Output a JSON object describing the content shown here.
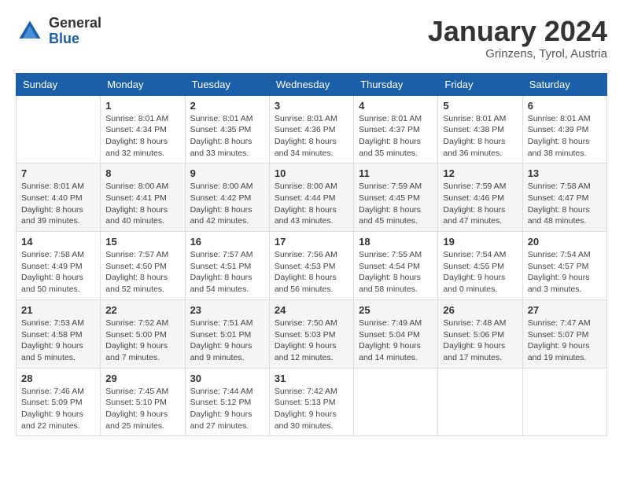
{
  "logo": {
    "general": "General",
    "blue": "Blue"
  },
  "header": {
    "month": "January 2024",
    "location": "Grinzens, Tyrol, Austria"
  },
  "weekdays": [
    "Sunday",
    "Monday",
    "Tuesday",
    "Wednesday",
    "Thursday",
    "Friday",
    "Saturday"
  ],
  "weeks": [
    [
      {
        "day": "",
        "info": ""
      },
      {
        "day": "1",
        "info": "Sunrise: 8:01 AM\nSunset: 4:34 PM\nDaylight: 8 hours\nand 32 minutes."
      },
      {
        "day": "2",
        "info": "Sunrise: 8:01 AM\nSunset: 4:35 PM\nDaylight: 8 hours\nand 33 minutes."
      },
      {
        "day": "3",
        "info": "Sunrise: 8:01 AM\nSunset: 4:36 PM\nDaylight: 8 hours\nand 34 minutes."
      },
      {
        "day": "4",
        "info": "Sunrise: 8:01 AM\nSunset: 4:37 PM\nDaylight: 8 hours\nand 35 minutes."
      },
      {
        "day": "5",
        "info": "Sunrise: 8:01 AM\nSunset: 4:38 PM\nDaylight: 8 hours\nand 36 minutes."
      },
      {
        "day": "6",
        "info": "Sunrise: 8:01 AM\nSunset: 4:39 PM\nDaylight: 8 hours\nand 38 minutes."
      }
    ],
    [
      {
        "day": "7",
        "info": "Sunrise: 8:01 AM\nSunset: 4:40 PM\nDaylight: 8 hours\nand 39 minutes."
      },
      {
        "day": "8",
        "info": "Sunrise: 8:00 AM\nSunset: 4:41 PM\nDaylight: 8 hours\nand 40 minutes."
      },
      {
        "day": "9",
        "info": "Sunrise: 8:00 AM\nSunset: 4:42 PM\nDaylight: 8 hours\nand 42 minutes."
      },
      {
        "day": "10",
        "info": "Sunrise: 8:00 AM\nSunset: 4:44 PM\nDaylight: 8 hours\nand 43 minutes."
      },
      {
        "day": "11",
        "info": "Sunrise: 7:59 AM\nSunset: 4:45 PM\nDaylight: 8 hours\nand 45 minutes."
      },
      {
        "day": "12",
        "info": "Sunrise: 7:59 AM\nSunset: 4:46 PM\nDaylight: 8 hours\nand 47 minutes."
      },
      {
        "day": "13",
        "info": "Sunrise: 7:58 AM\nSunset: 4:47 PM\nDaylight: 8 hours\nand 48 minutes."
      }
    ],
    [
      {
        "day": "14",
        "info": "Sunrise: 7:58 AM\nSunset: 4:49 PM\nDaylight: 8 hours\nand 50 minutes."
      },
      {
        "day": "15",
        "info": "Sunrise: 7:57 AM\nSunset: 4:50 PM\nDaylight: 8 hours\nand 52 minutes."
      },
      {
        "day": "16",
        "info": "Sunrise: 7:57 AM\nSunset: 4:51 PM\nDaylight: 8 hours\nand 54 minutes."
      },
      {
        "day": "17",
        "info": "Sunrise: 7:56 AM\nSunset: 4:53 PM\nDaylight: 8 hours\nand 56 minutes."
      },
      {
        "day": "18",
        "info": "Sunrise: 7:55 AM\nSunset: 4:54 PM\nDaylight: 8 hours\nand 58 minutes."
      },
      {
        "day": "19",
        "info": "Sunrise: 7:54 AM\nSunset: 4:55 PM\nDaylight: 9 hours\nand 0 minutes."
      },
      {
        "day": "20",
        "info": "Sunrise: 7:54 AM\nSunset: 4:57 PM\nDaylight: 9 hours\nand 3 minutes."
      }
    ],
    [
      {
        "day": "21",
        "info": "Sunrise: 7:53 AM\nSunset: 4:58 PM\nDaylight: 9 hours\nand 5 minutes."
      },
      {
        "day": "22",
        "info": "Sunrise: 7:52 AM\nSunset: 5:00 PM\nDaylight: 9 hours\nand 7 minutes."
      },
      {
        "day": "23",
        "info": "Sunrise: 7:51 AM\nSunset: 5:01 PM\nDaylight: 9 hours\nand 9 minutes."
      },
      {
        "day": "24",
        "info": "Sunrise: 7:50 AM\nSunset: 5:03 PM\nDaylight: 9 hours\nand 12 minutes."
      },
      {
        "day": "25",
        "info": "Sunrise: 7:49 AM\nSunset: 5:04 PM\nDaylight: 9 hours\nand 14 minutes."
      },
      {
        "day": "26",
        "info": "Sunrise: 7:48 AM\nSunset: 5:06 PM\nDaylight: 9 hours\nand 17 minutes."
      },
      {
        "day": "27",
        "info": "Sunrise: 7:47 AM\nSunset: 5:07 PM\nDaylight: 9 hours\nand 19 minutes."
      }
    ],
    [
      {
        "day": "28",
        "info": "Sunrise: 7:46 AM\nSunset: 5:09 PM\nDaylight: 9 hours\nand 22 minutes."
      },
      {
        "day": "29",
        "info": "Sunrise: 7:45 AM\nSunset: 5:10 PM\nDaylight: 9 hours\nand 25 minutes."
      },
      {
        "day": "30",
        "info": "Sunrise: 7:44 AM\nSunset: 5:12 PM\nDaylight: 9 hours\nand 27 minutes."
      },
      {
        "day": "31",
        "info": "Sunrise: 7:42 AM\nSunset: 5:13 PM\nDaylight: 9 hours\nand 30 minutes."
      },
      {
        "day": "",
        "info": ""
      },
      {
        "day": "",
        "info": ""
      },
      {
        "day": "",
        "info": ""
      }
    ]
  ]
}
